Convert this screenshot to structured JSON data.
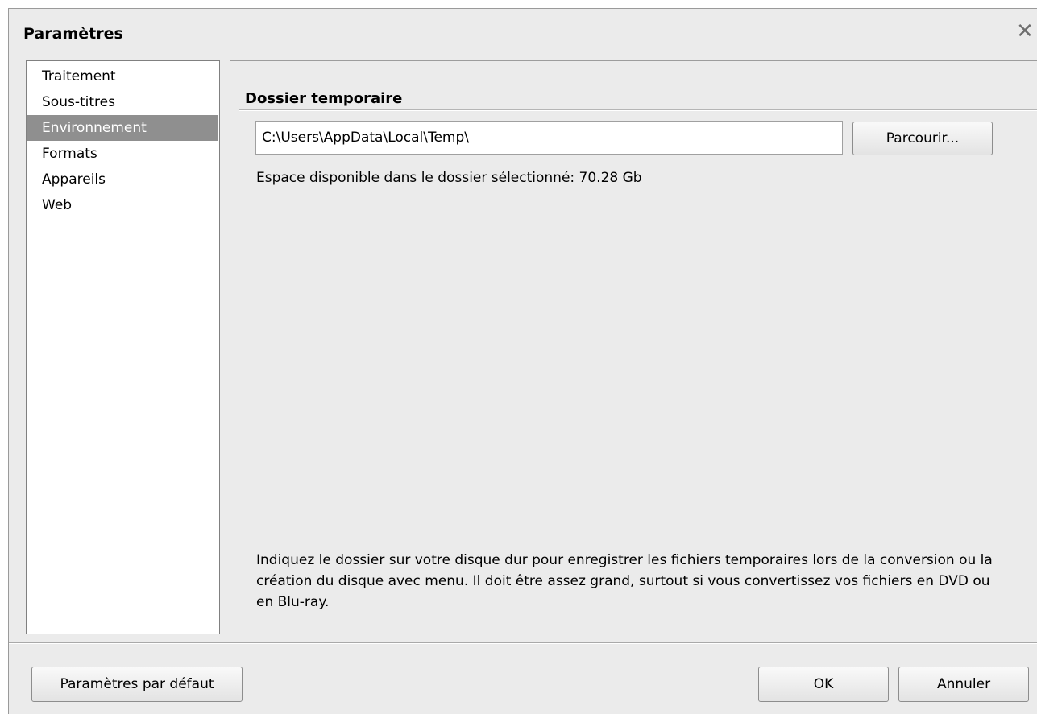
{
  "window": {
    "title": "Paramètres",
    "close_glyph": "✕"
  },
  "sidebar": {
    "items": [
      {
        "label": "Traitement",
        "selected": false
      },
      {
        "label": "Sous-titres",
        "selected": false
      },
      {
        "label": "Environnement",
        "selected": true
      },
      {
        "label": "Formats",
        "selected": false
      },
      {
        "label": "Appareils",
        "selected": false
      },
      {
        "label": "Web",
        "selected": false
      }
    ]
  },
  "main": {
    "section_title": "Dossier temporaire",
    "path_value": "C:\\Users\\AppData\\Local\\Temp\\",
    "browse_label": "Parcourir...",
    "space_text": "Espace disponible dans le dossier sélectionné: 70.28 Gb",
    "help_text": "Indiquez le dossier sur votre disque dur pour enregistrer les fichiers temporaires lors de la conversion ou la création du disque avec menu. Il doit être assez grand, surtout si vous convertissez vos fichiers en DVD ou en Blu-ray."
  },
  "footer": {
    "default_label": "Paramètres par défaut",
    "ok_label": "OK",
    "cancel_label": "Annuler"
  },
  "colors": {
    "window_bg": "#ebebeb",
    "selected_bg": "#8f8f8f"
  }
}
